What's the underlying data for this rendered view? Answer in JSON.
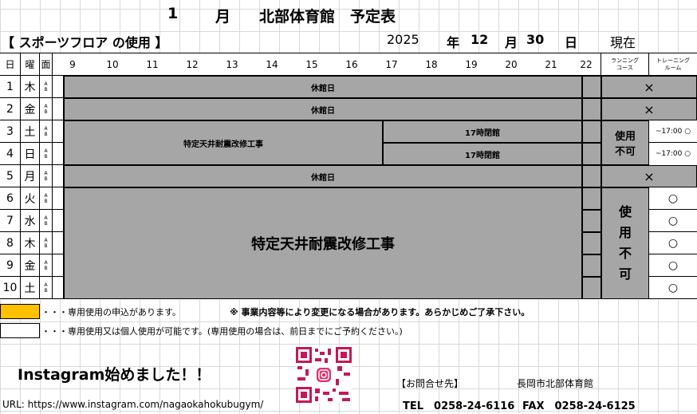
{
  "header": {
    "month": "1",
    "month_unit": "月",
    "title": "北部体育館　予定表",
    "facility": "【 スポーツフロア の使用 】",
    "year": "2025",
    "year_unit": "年",
    "as_of_month": "12",
    "as_of_month_unit": "月",
    "as_of_day": "30",
    "as_of_day_unit": "日",
    "as_of_label": "現在"
  },
  "columns": {
    "day": "日",
    "weekday": "曜",
    "court": "面",
    "hours": [
      "9",
      "10",
      "11",
      "12",
      "13",
      "14",
      "15",
      "16",
      "17",
      "18",
      "19",
      "20",
      "21",
      "22"
    ],
    "running": "ランニング\nコース",
    "training": "トレーニング\nルーム"
  },
  "rows": [
    {
      "day": "1",
      "weekday": "木",
      "ab": "A\nB"
    },
    {
      "day": "2",
      "weekday": "金",
      "ab": "A\nB"
    },
    {
      "day": "3",
      "weekday": "土",
      "ab": "A\nB"
    },
    {
      "day": "4",
      "weekday": "日",
      "ab": "A\nB"
    },
    {
      "day": "5",
      "weekday": "月",
      "ab": "A\nB"
    },
    {
      "day": "6",
      "weekday": "火",
      "ab": "A\nB"
    },
    {
      "day": "7",
      "weekday": "水",
      "ab": "A\nB"
    },
    {
      "day": "8",
      "weekday": "木",
      "ab": "A\nB"
    },
    {
      "day": "9",
      "weekday": "金",
      "ab": "A\nB"
    },
    {
      "day": "10",
      "weekday": "土",
      "ab": "A\nB"
    }
  ],
  "blocks": {
    "closed": "休館日",
    "construction": "特定天井耐震改修工事",
    "close17": "17時閉館",
    "unavailable_small": "使用\n不可",
    "unavailable_large": "使\n用\n不\n可"
  },
  "marks": {
    "cross": "×",
    "circle": "○",
    "until17": "~17:00 ○"
  },
  "legend": {
    "reserved_color": "#ffc000",
    "reserved_text": "・・・専用使用の申込があります。",
    "open_text": "・・・専用使用又は個人使用が可能です。(専用使用の場合は、前日までにご予約ください。)",
    "notice": "※ 事業内容等により変更になる場合があります。あらかじめご了承下さい。"
  },
  "footer": {
    "instagram": "Instagram始めました！！",
    "url": "URL: https://www.instagram.com/nagaokahokubugym/",
    "contact_label": "【お問合せ先】",
    "contact_name": "長岡市北部体育館",
    "tel": "TEL　0258-24-6116",
    "fax": "FAX　0258-24-6125"
  }
}
